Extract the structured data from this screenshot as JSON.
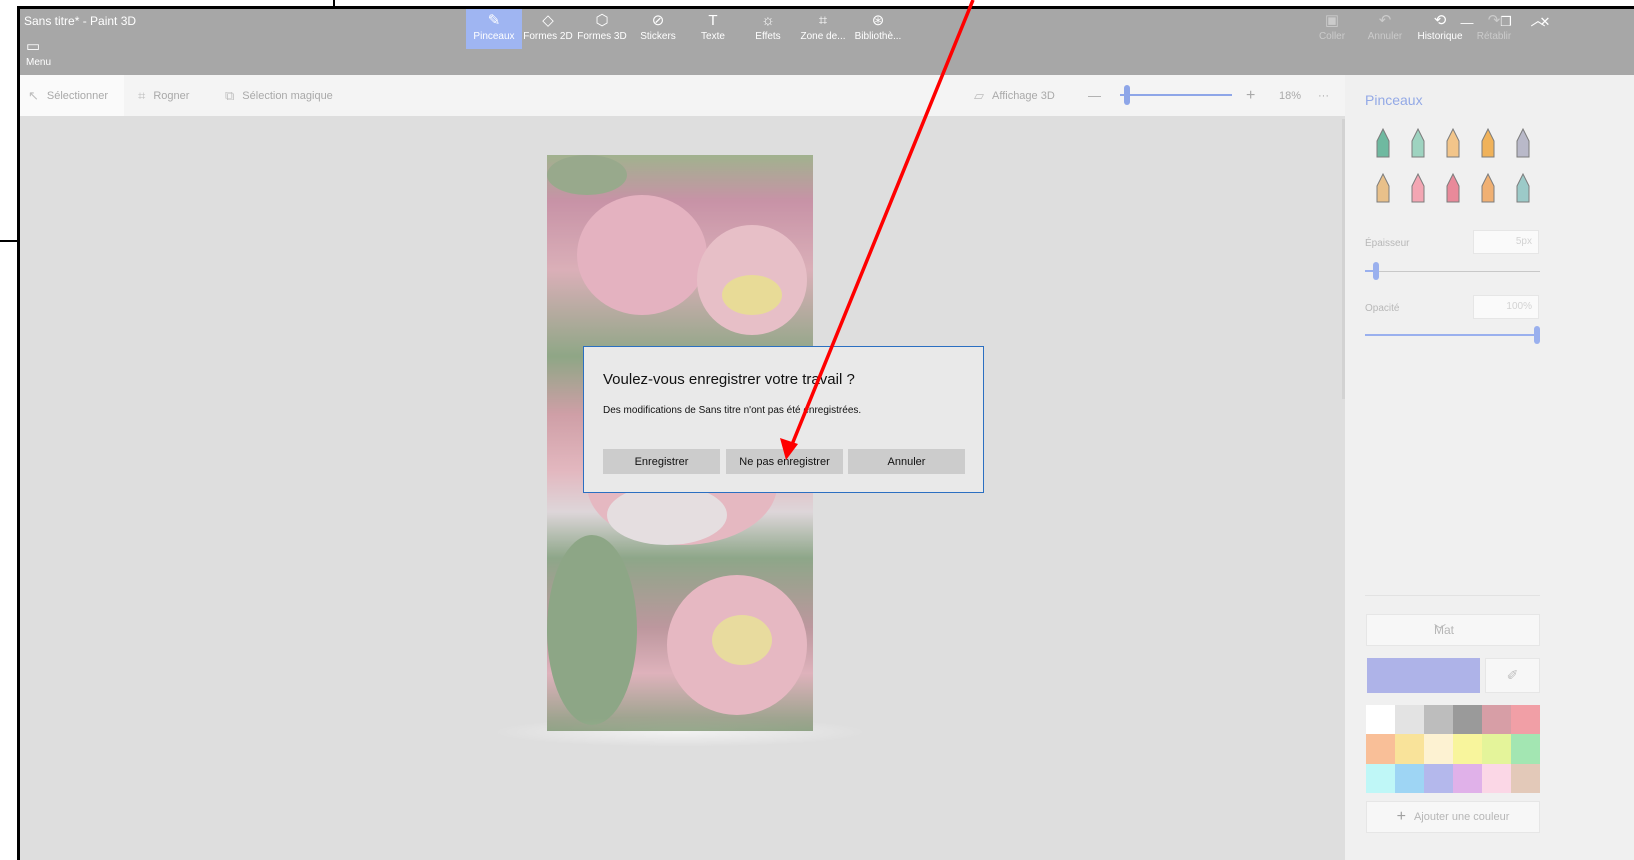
{
  "window": {
    "title": "Sans titre* - Paint 3D",
    "minimize_icon": "—",
    "restore_icon": "❐",
    "close_icon": "✕"
  },
  "toolbar": {
    "menu_label": "Menu",
    "tools": [
      {
        "label": "Pinceaux",
        "icon": "brush-icon",
        "active": true
      },
      {
        "label": "Formes 2D",
        "icon": "shapes-2d-icon"
      },
      {
        "label": "Formes 3D",
        "icon": "cube-icon"
      },
      {
        "label": "Stickers",
        "icon": "sticker-icon"
      },
      {
        "label": "Texte",
        "icon": "text-icon"
      },
      {
        "label": "Effets",
        "icon": "sun-icon"
      },
      {
        "label": "Zone de...",
        "icon": "crop-canvas-icon"
      },
      {
        "label": "Bibliothè...",
        "icon": "library-icon"
      }
    ],
    "right_tools": [
      {
        "label": "Coller",
        "icon": "paste-icon",
        "enabled": false
      },
      {
        "label": "Annuler",
        "icon": "undo-icon",
        "enabled": false
      },
      {
        "label": "Historique",
        "icon": "history-icon",
        "enabled": true
      },
      {
        "label": "Rétablir",
        "icon": "redo-icon",
        "enabled": false
      }
    ]
  },
  "subbar": {
    "select_label": "Sélectionner",
    "crop_label": "Rogner",
    "magic_select_label": "Sélection magique",
    "view3d_label": "Affichage 3D",
    "zoom_minus": "—",
    "zoom_plus": "+",
    "zoom_level": "18%",
    "more": "···"
  },
  "sidepanel": {
    "title": "Pinceaux",
    "brushes": [
      {
        "name": "marker",
        "color": "#6fb9a0"
      },
      {
        "name": "calligraphy-pen",
        "color": "#9ed3c0"
      },
      {
        "name": "oil-brush",
        "color": "#f2c58a"
      },
      {
        "name": "watercolor",
        "color": "#f0b25a"
      },
      {
        "name": "pixel-pen",
        "color": "#b9b9c9"
      },
      {
        "name": "pencil",
        "color": "#e8c08a"
      },
      {
        "name": "eraser",
        "color": "#f3a6b3"
      },
      {
        "name": "crayon",
        "color": "#e88a9a"
      },
      {
        "name": "spray-can",
        "color": "#f0b073"
      },
      {
        "name": "fill",
        "color": "#9ccac8"
      }
    ],
    "thickness_label": "Épaisseur",
    "thickness_value": "5px",
    "thickness_level": 0.05,
    "opacity_label": "Opacité",
    "opacity_value": "100%",
    "opacity_level": 1.0,
    "finish_label": "Mat",
    "current_color": "#aeb3e8",
    "palette": [
      "#ffffff",
      "#e3e3e3",
      "#bdbdbd",
      "#9a9a9a",
      "#d79ea6",
      "#f19fa6",
      "#f9bf98",
      "#f9e39a",
      "#fdf2d2",
      "#f8f59c",
      "#e4f49a",
      "#a3e6b2",
      "#bff7f7",
      "#9ed5f4",
      "#b4b8ec",
      "#e0b1e9",
      "#fbd7e6",
      "#e3c9b9"
    ],
    "add_color_label": "Ajouter une couleur"
  },
  "dialog": {
    "title": "Voulez-vous enregistrer votre travail ?",
    "message": "Des modifications de Sans titre n'ont pas été enregistrées.",
    "save_label": "Enregistrer",
    "dont_save_label": "Ne pas enregistrer",
    "cancel_label": "Annuler"
  },
  "annotation": {
    "arrow_color": "#ff0000"
  }
}
